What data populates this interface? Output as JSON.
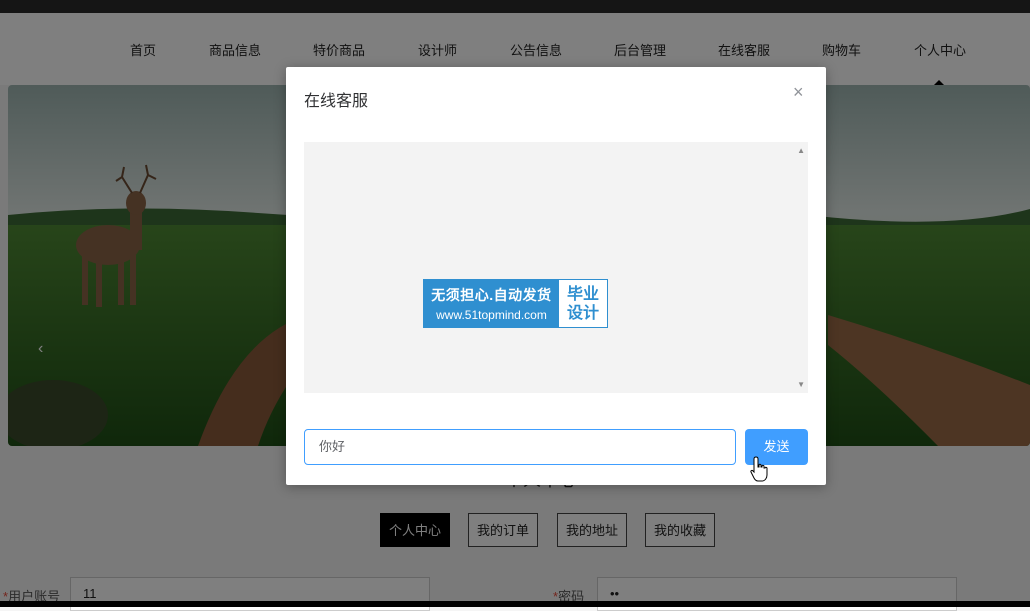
{
  "nav": {
    "items": [
      {
        "label": "首页"
      },
      {
        "label": "商品信息"
      },
      {
        "label": "特价商品"
      },
      {
        "label": "设计师"
      },
      {
        "label": "公告信息"
      },
      {
        "label": "后台管理"
      },
      {
        "label": "在线客服"
      },
      {
        "label": "购物车"
      },
      {
        "label": "个人中心"
      }
    ],
    "active": "个人中心"
  },
  "banner": {
    "prev_arrow": "‹"
  },
  "profile": {
    "section_title": "个人中心",
    "tabs": [
      {
        "label": "个人中心",
        "active": true
      },
      {
        "label": "我的订单",
        "active": false
      },
      {
        "label": "我的地址",
        "active": false
      },
      {
        "label": "我的收藏",
        "active": false
      }
    ],
    "form": {
      "account_label": "用户账号",
      "account_value": "11",
      "password_label": "密码",
      "password_value": "••",
      "required_mark": "*"
    }
  },
  "modal": {
    "title": "在线客服",
    "close_icon": "×",
    "chat": {
      "scroll_up": "▲",
      "scroll_down": "▼"
    },
    "watermark": {
      "line1": "无须担心.自动发货",
      "line2": "www.51topmind.com",
      "right_top": "毕业",
      "right_bottom": "设计"
    },
    "input_value": "你好",
    "send_label": "发送"
  },
  "colors": {
    "accent": "#409eff",
    "watermark_blue": "#2f8fd0",
    "required": "#e74c3c"
  }
}
